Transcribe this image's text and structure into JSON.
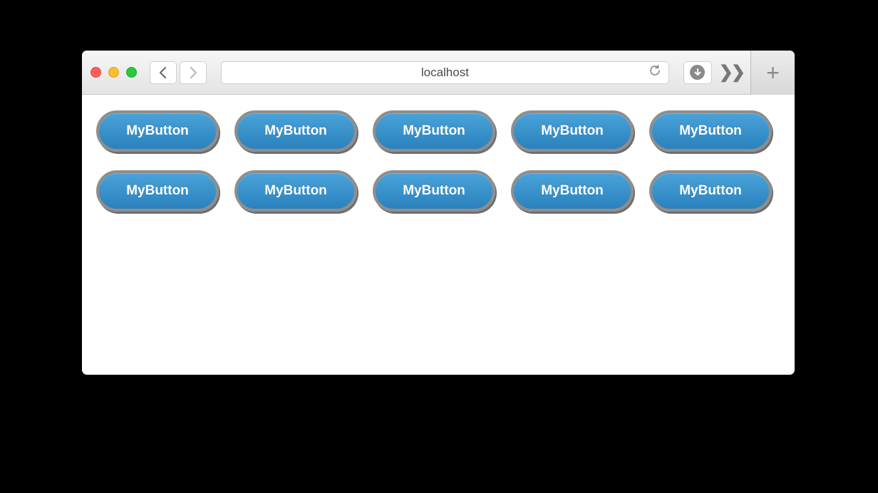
{
  "browser": {
    "address": "localhost"
  },
  "page": {
    "rows": [
      {
        "buttons": [
          "MyButton",
          "MyButton",
          "MyButton",
          "MyButton",
          "MyButton"
        ]
      },
      {
        "buttons": [
          "MyButton",
          "MyButton",
          "MyButton",
          "MyButton",
          "MyButton"
        ]
      }
    ]
  }
}
